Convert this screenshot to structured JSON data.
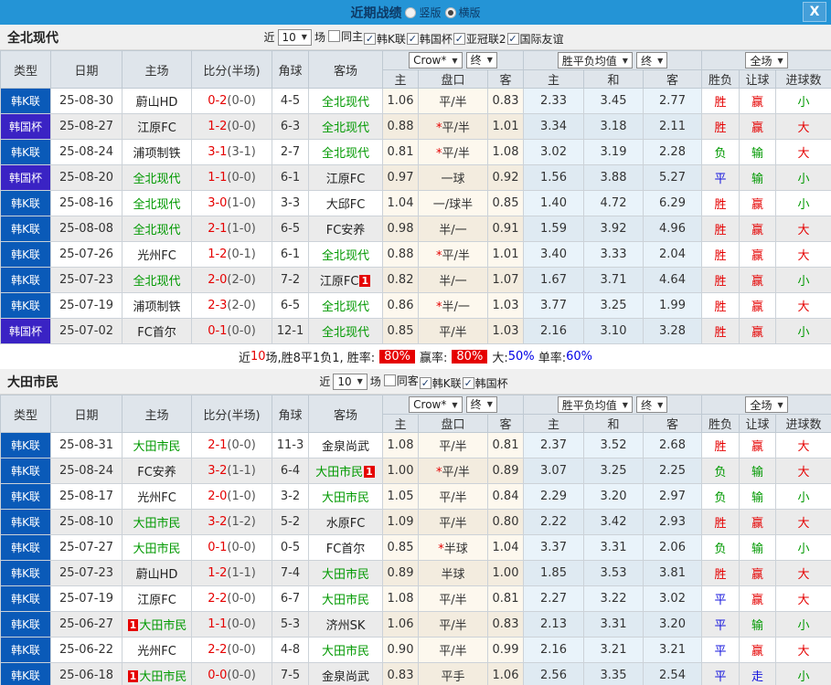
{
  "title_bar": {
    "title": "近期战绩",
    "vertical": "竖版",
    "horizontal": "横版",
    "close_icon": "X"
  },
  "colors": {
    "titlebar": "#2494d6",
    "league_k_blue": "#0a5ab8",
    "league_cup_purple": "#3a23c4",
    "team_green": "#009900",
    "score_red": "#e50000",
    "result_red": "#e50000",
    "result_green": "#009900",
    "result_blue": "#1414dd",
    "rate_badge_red": "#e50000",
    "rate_blue": "#0000e6"
  },
  "table_header": {
    "type": "类型",
    "date": "日期",
    "home": "主场",
    "score": "比分(半场)",
    "corners": "角球",
    "away": "客场",
    "odds_source_select": "Crow*",
    "odds_stage_select": "终",
    "odds_sub_home": "主",
    "odds_sub_line": "盘口",
    "odds_sub_away": "客",
    "avg_select": "胜平负均值",
    "avg_stage_select": "终",
    "avg_sub_home": "主",
    "avg_sub_draw": "和",
    "avg_sub_away": "客",
    "scope_select": "全场",
    "result_sub_wdl": "胜负",
    "result_sub_handicap": "让球",
    "result_sub_goals": "进球数"
  },
  "sections": [
    {
      "team": "全北现代",
      "filter": {
        "near": "近",
        "count": "10",
        "games": "场",
        "checkboxes": [
          {
            "label": "同主",
            "checked": false
          },
          {
            "label": "韩K联",
            "checked": true
          },
          {
            "label": "韩国杯",
            "checked": true
          },
          {
            "label": "亚冠联2",
            "checked": true
          },
          {
            "label": "国际友谊",
            "checked": true
          }
        ]
      },
      "rows": [
        {
          "league": "韩K联",
          "date": "25-08-30",
          "home": "蔚山HD",
          "home_green": false,
          "score": "0-2",
          "half": "(0-0)",
          "corners": "4-5",
          "away": "全北现代",
          "away_green": true,
          "odds_home": "1.06",
          "line": "平/半",
          "line_star": false,
          "odds_away": "0.83",
          "avg_home": "2.33",
          "avg_draw": "3.45",
          "avg_away": "2.77",
          "res_wdl": "胜",
          "res_let": "赢",
          "res_goal": "小"
        },
        {
          "league": "韩国杯",
          "date": "25-08-27",
          "home": "江原FC",
          "home_green": false,
          "score": "1-2",
          "half": "(0-0)",
          "corners": "6-3",
          "away": "全北现代",
          "away_green": true,
          "odds_home": "0.88",
          "line": "平/半",
          "line_star": true,
          "odds_away": "1.01",
          "avg_home": "3.34",
          "avg_draw": "3.18",
          "avg_away": "2.11",
          "res_wdl": "胜",
          "res_let": "赢",
          "res_goal": "大"
        },
        {
          "league": "韩K联",
          "date": "25-08-24",
          "home": "浦项制铁",
          "home_green": false,
          "score": "3-1",
          "half": "(3-1)",
          "corners": "2-7",
          "away": "全北现代",
          "away_green": true,
          "odds_home": "0.81",
          "line": "平/半",
          "line_star": true,
          "odds_away": "1.08",
          "avg_home": "3.02",
          "avg_draw": "3.19",
          "avg_away": "2.28",
          "res_wdl": "负",
          "res_let": "输",
          "res_goal": "大"
        },
        {
          "league": "韩国杯",
          "date": "25-08-20",
          "home": "全北现代",
          "home_green": true,
          "score": "1-1",
          "half": "(0-0)",
          "corners": "6-1",
          "away": "江原FC",
          "away_green": false,
          "odds_home": "0.97",
          "line": "一球",
          "line_star": false,
          "odds_away": "0.92",
          "avg_home": "1.56",
          "avg_draw": "3.88",
          "avg_away": "5.27",
          "res_wdl": "平",
          "res_let": "输",
          "res_goal": "小"
        },
        {
          "league": "韩K联",
          "date": "25-08-16",
          "home": "全北现代",
          "home_green": true,
          "score": "3-0",
          "half": "(1-0)",
          "corners": "3-3",
          "away": "大邱FC",
          "away_green": false,
          "odds_home": "1.04",
          "line": "一/球半",
          "line_star": false,
          "odds_away": "0.85",
          "avg_home": "1.40",
          "avg_draw": "4.72",
          "avg_away": "6.29",
          "res_wdl": "胜",
          "res_let": "赢",
          "res_goal": "小"
        },
        {
          "league": "韩K联",
          "date": "25-08-08",
          "home": "全北现代",
          "home_green": true,
          "score": "2-1",
          "half": "(1-0)",
          "corners": "6-5",
          "away": "FC安养",
          "away_green": false,
          "odds_home": "0.98",
          "line": "半/一",
          "line_star": false,
          "odds_away": "0.91",
          "avg_home": "1.59",
          "avg_draw": "3.92",
          "avg_away": "4.96",
          "res_wdl": "胜",
          "res_let": "赢",
          "res_goal": "大"
        },
        {
          "league": "韩K联",
          "date": "25-07-26",
          "home": "光州FC",
          "home_green": false,
          "score": "1-2",
          "half": "(0-1)",
          "corners": "6-1",
          "away": "全北现代",
          "away_green": true,
          "odds_home": "0.88",
          "line": "平/半",
          "line_star": true,
          "odds_away": "1.01",
          "avg_home": "3.40",
          "avg_draw": "3.33",
          "avg_away": "2.04",
          "res_wdl": "胜",
          "res_let": "赢",
          "res_goal": "大"
        },
        {
          "league": "韩K联",
          "date": "25-07-23",
          "home": "全北现代",
          "home_green": true,
          "score": "2-0",
          "half": "(2-0)",
          "corners": "7-2",
          "away": "江原FC",
          "away_green": false,
          "away_badge": "1",
          "away_badge_pos": "post",
          "odds_home": "0.82",
          "line": "半/一",
          "line_star": false,
          "odds_away": "1.07",
          "avg_home": "1.67",
          "avg_draw": "3.71",
          "avg_away": "4.64",
          "res_wdl": "胜",
          "res_let": "赢",
          "res_goal": "小"
        },
        {
          "league": "韩K联",
          "date": "25-07-19",
          "home": "浦项制铁",
          "home_green": false,
          "score": "2-3",
          "half": "(2-0)",
          "corners": "6-5",
          "away": "全北现代",
          "away_green": true,
          "odds_home": "0.86",
          "line": "半/一",
          "line_star": true,
          "odds_away": "1.03",
          "avg_home": "3.77",
          "avg_draw": "3.25",
          "avg_away": "1.99",
          "res_wdl": "胜",
          "res_let": "赢",
          "res_goal": "大"
        },
        {
          "league": "韩国杯",
          "date": "25-07-02",
          "home": "FC首尔",
          "home_green": false,
          "score": "0-1",
          "half": "(0-0)",
          "corners": "12-1",
          "away": "全北现代",
          "away_green": true,
          "odds_home": "0.85",
          "line": "平/半",
          "line_star": false,
          "odds_away": "1.03",
          "avg_home": "2.16",
          "avg_draw": "3.10",
          "avg_away": "3.28",
          "res_wdl": "胜",
          "res_let": "赢",
          "res_goal": "小"
        }
      ],
      "summary_parts": [
        {
          "text": "近",
          "style": "plain"
        },
        {
          "text": "10",
          "style": "red"
        },
        {
          "text": "场,胜8平1负1, 胜率:",
          "style": "plain"
        },
        {
          "text": "80%",
          "style": "badge"
        },
        {
          "text": "赢率:",
          "style": "plain"
        },
        {
          "text": "80%",
          "style": "badge"
        },
        {
          "text": "大:",
          "style": "plain"
        },
        {
          "text": "50%",
          "style": "blue"
        },
        {
          "text": " 单率:",
          "style": "plain"
        },
        {
          "text": "60%",
          "style": "blue"
        }
      ]
    },
    {
      "team": "大田市民",
      "filter": {
        "near": "近",
        "count": "10",
        "games": "场",
        "checkboxes": [
          {
            "label": "同客",
            "checked": false
          },
          {
            "label": "韩K联",
            "checked": true
          },
          {
            "label": "韩国杯",
            "checked": true
          }
        ]
      },
      "rows": [
        {
          "league": "韩K联",
          "date": "25-08-31",
          "home": "大田市民",
          "home_green": true,
          "score": "2-1",
          "half": "(0-0)",
          "corners": "11-3",
          "away": "金泉尚武",
          "away_green": false,
          "odds_home": "1.08",
          "line": "平/半",
          "line_star": false,
          "odds_away": "0.81",
          "avg_home": "2.37",
          "avg_draw": "3.52",
          "avg_away": "2.68",
          "res_wdl": "胜",
          "res_let": "赢",
          "res_goal": "大"
        },
        {
          "league": "韩K联",
          "date": "25-08-24",
          "home": "FC安养",
          "home_green": false,
          "score": "3-2",
          "half": "(1-1)",
          "corners": "6-4",
          "away": "大田市民",
          "away_green": true,
          "away_badge": "1",
          "away_badge_pos": "post",
          "odds_home": "1.00",
          "line": "平/半",
          "line_star": true,
          "odds_away": "0.89",
          "avg_home": "3.07",
          "avg_draw": "3.25",
          "avg_away": "2.25",
          "res_wdl": "负",
          "res_let": "输",
          "res_goal": "大"
        },
        {
          "league": "韩K联",
          "date": "25-08-17",
          "home": "光州FC",
          "home_green": false,
          "score": "2-0",
          "half": "(1-0)",
          "corners": "3-2",
          "away": "大田市民",
          "away_green": true,
          "odds_home": "1.05",
          "line": "平/半",
          "line_star": false,
          "odds_away": "0.84",
          "avg_home": "2.29",
          "avg_draw": "3.20",
          "avg_away": "2.97",
          "res_wdl": "负",
          "res_let": "输",
          "res_goal": "小"
        },
        {
          "league": "韩K联",
          "date": "25-08-10",
          "home": "大田市民",
          "home_green": true,
          "score": "3-2",
          "half": "(1-2)",
          "corners": "5-2",
          "away": "水原FC",
          "away_green": false,
          "odds_home": "1.09",
          "line": "平/半",
          "line_star": false,
          "odds_away": "0.80",
          "avg_home": "2.22",
          "avg_draw": "3.42",
          "avg_away": "2.93",
          "res_wdl": "胜",
          "res_let": "赢",
          "res_goal": "大"
        },
        {
          "league": "韩K联",
          "date": "25-07-27",
          "home": "大田市民",
          "home_green": true,
          "score": "0-1",
          "half": "(0-0)",
          "corners": "0-5",
          "away": "FC首尔",
          "away_green": false,
          "odds_home": "0.85",
          "line": "半球",
          "line_star": true,
          "odds_away": "1.04",
          "avg_home": "3.37",
          "avg_draw": "3.31",
          "avg_away": "2.06",
          "res_wdl": "负",
          "res_let": "输",
          "res_goal": "小"
        },
        {
          "league": "韩K联",
          "date": "25-07-23",
          "home": "蔚山HD",
          "home_green": false,
          "score": "1-2",
          "half": "(1-1)",
          "corners": "7-4",
          "away": "大田市民",
          "away_green": true,
          "odds_home": "0.89",
          "line": "半球",
          "line_star": false,
          "odds_away": "1.00",
          "avg_home": "1.85",
          "avg_draw": "3.53",
          "avg_away": "3.81",
          "res_wdl": "胜",
          "res_let": "赢",
          "res_goal": "大"
        },
        {
          "league": "韩K联",
          "date": "25-07-19",
          "home": "江原FC",
          "home_green": false,
          "score": "2-2",
          "half": "(0-0)",
          "corners": "6-7",
          "away": "大田市民",
          "away_green": true,
          "odds_home": "1.08",
          "line": "平/半",
          "line_star": false,
          "odds_away": "0.81",
          "avg_home": "2.27",
          "avg_draw": "3.22",
          "avg_away": "3.02",
          "res_wdl": "平",
          "res_let": "赢",
          "res_goal": "大"
        },
        {
          "league": "韩K联",
          "date": "25-06-27",
          "home": "大田市民",
          "home_green": true,
          "home_badge": "1",
          "home_badge_pos": "pre",
          "score": "1-1",
          "half": "(0-0)",
          "corners": "5-3",
          "away": "济州SK",
          "away_green": false,
          "odds_home": "1.06",
          "line": "平/半",
          "line_star": false,
          "odds_away": "0.83",
          "avg_home": "2.13",
          "avg_draw": "3.31",
          "avg_away": "3.20",
          "res_wdl": "平",
          "res_let": "输",
          "res_goal": "小"
        },
        {
          "league": "韩K联",
          "date": "25-06-22",
          "home": "光州FC",
          "home_green": false,
          "score": "2-2",
          "half": "(0-0)",
          "corners": "4-8",
          "away": "大田市民",
          "away_green": true,
          "odds_home": "0.90",
          "line": "平/半",
          "line_star": false,
          "odds_away": "0.99",
          "avg_home": "2.16",
          "avg_draw": "3.21",
          "avg_away": "3.21",
          "res_wdl": "平",
          "res_let": "赢",
          "res_goal": "大"
        },
        {
          "league": "韩K联",
          "date": "25-06-18",
          "home": "大田市民",
          "home_green": true,
          "home_badge": "1",
          "home_badge_pos": "pre",
          "score": "0-0",
          "half": "(0-0)",
          "corners": "7-5",
          "away": "金泉尚武",
          "away_green": false,
          "odds_home": "0.83",
          "line": "平手",
          "line_star": false,
          "odds_away": "1.06",
          "avg_home": "2.56",
          "avg_draw": "3.35",
          "avg_away": "2.54",
          "res_wdl": "平",
          "res_let": "走",
          "res_goal": "小"
        }
      ],
      "summary_parts": []
    }
  ]
}
